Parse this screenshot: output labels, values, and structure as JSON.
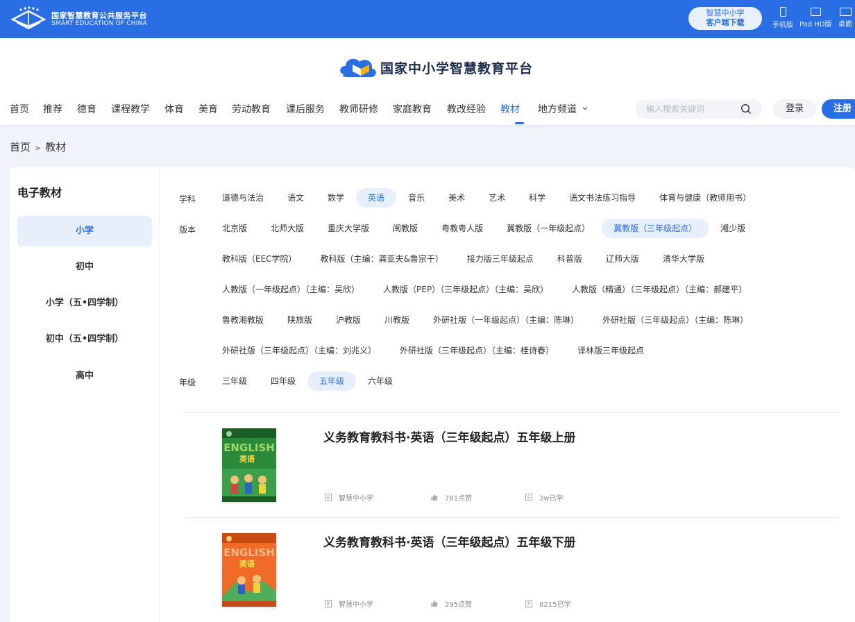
{
  "topbar": {
    "brand_cn": "国家智慧教育公共服务平台",
    "brand_en": "SMART EDUCATION OF CHINA",
    "download_line1": "智慧中小学",
    "download_line2": "客户端下载",
    "devices": [
      {
        "label": "手机版",
        "icon": "phone-icon"
      },
      {
        "label": "Pad HD版",
        "icon": "tablet-icon"
      },
      {
        "label": "桌面",
        "icon": "desktop-icon"
      }
    ],
    "colors": {
      "primary": "#2a6ee6"
    }
  },
  "header": {
    "site_title": "国家中小学智慧教育平台",
    "nav": [
      {
        "label": "首页"
      },
      {
        "label": "推荐"
      },
      {
        "label": "德育"
      },
      {
        "label": "课程教学"
      },
      {
        "label": "体育"
      },
      {
        "label": "美育"
      },
      {
        "label": "劳动教育"
      },
      {
        "label": "课后服务"
      },
      {
        "label": "教师研修"
      },
      {
        "label": "家庭教育"
      },
      {
        "label": "教改经验"
      },
      {
        "label": "教材",
        "active": true
      },
      {
        "label": "地方频道"
      }
    ],
    "search_placeholder": "输入搜索关键词",
    "login": "登录",
    "register": "注册"
  },
  "breadcrumb": {
    "home": "首页",
    "sep": ">",
    "current": "教材"
  },
  "sidebar": {
    "title": "电子教材",
    "items": [
      {
        "label": "小学",
        "active": true
      },
      {
        "label": "初中"
      },
      {
        "label": "小学（五•四学制）"
      },
      {
        "label": "初中（五•四学制）"
      },
      {
        "label": "高中"
      }
    ]
  },
  "filters": {
    "subject_label": "学科",
    "subjects": [
      "道德与法治",
      "语文",
      "数学",
      "英语",
      "音乐",
      "美术",
      "艺术",
      "科学",
      "语文书法练习指导",
      "体育与健康（教师用书）"
    ],
    "subject_active": "英语",
    "edition_label": "版本",
    "edition_rows": [
      [
        "北京版",
        "北师大版",
        "重庆大学版",
        "闽教版",
        "粤教粤人版",
        "冀教版（一年级起点）",
        "冀教版（三年级起点）",
        "湘少版"
      ],
      [
        "教科版（EEC学院）",
        "教科版（主编：龚亚夫&鲁宗干）",
        "接力版三年级起点",
        "科普版",
        "辽师大版",
        "清华大学版"
      ],
      [
        "人教版（一年级起点）（主编：吴欣）",
        "人教版（PEP）（三年级起点）（主编：吴欣）",
        "人教版（精通）（三年级起点）（主编：郝建平）"
      ],
      [
        "鲁教湘教版",
        "陕旅版",
        "沪教版",
        "川教版",
        "外研社版（一年级起点）（主编：陈琳）",
        "外研社版（三年级起点）（主编：陈琳）"
      ],
      [
        "外研社版（三年级起点）（主编：刘兆义）",
        "外研社版（三年级起点）（主编：桂诗春）",
        "译林版三年级起点"
      ]
    ],
    "edition_active": "冀教版（三年级起点）",
    "grade_label": "年级",
    "grades": [
      "三年级",
      "四年级",
      "五年级",
      "六年级"
    ],
    "grade_active": "五年级"
  },
  "books": [
    {
      "title": "义务教育教科书·英语（三年级起点）五年级上册",
      "publisher": "智慧中小学",
      "likes": "781点赞",
      "learners": "2w已学",
      "cover_colors": {
        "bg": "#2a8a3a",
        "band": "#1b5e25"
      },
      "cover_text_en": "ENGLISH",
      "cover_text_cn": "英语"
    },
    {
      "title": "义务教育教科书·英语（三年级起点）五年级下册",
      "publisher": "智慧中小学",
      "likes": "295点赞",
      "learners": "8215已学",
      "cover_colors": {
        "bg": "#f06a28",
        "band": "#c94a12"
      },
      "cover_text_en": "ENGLISH",
      "cover_text_cn": "英语"
    }
  ]
}
